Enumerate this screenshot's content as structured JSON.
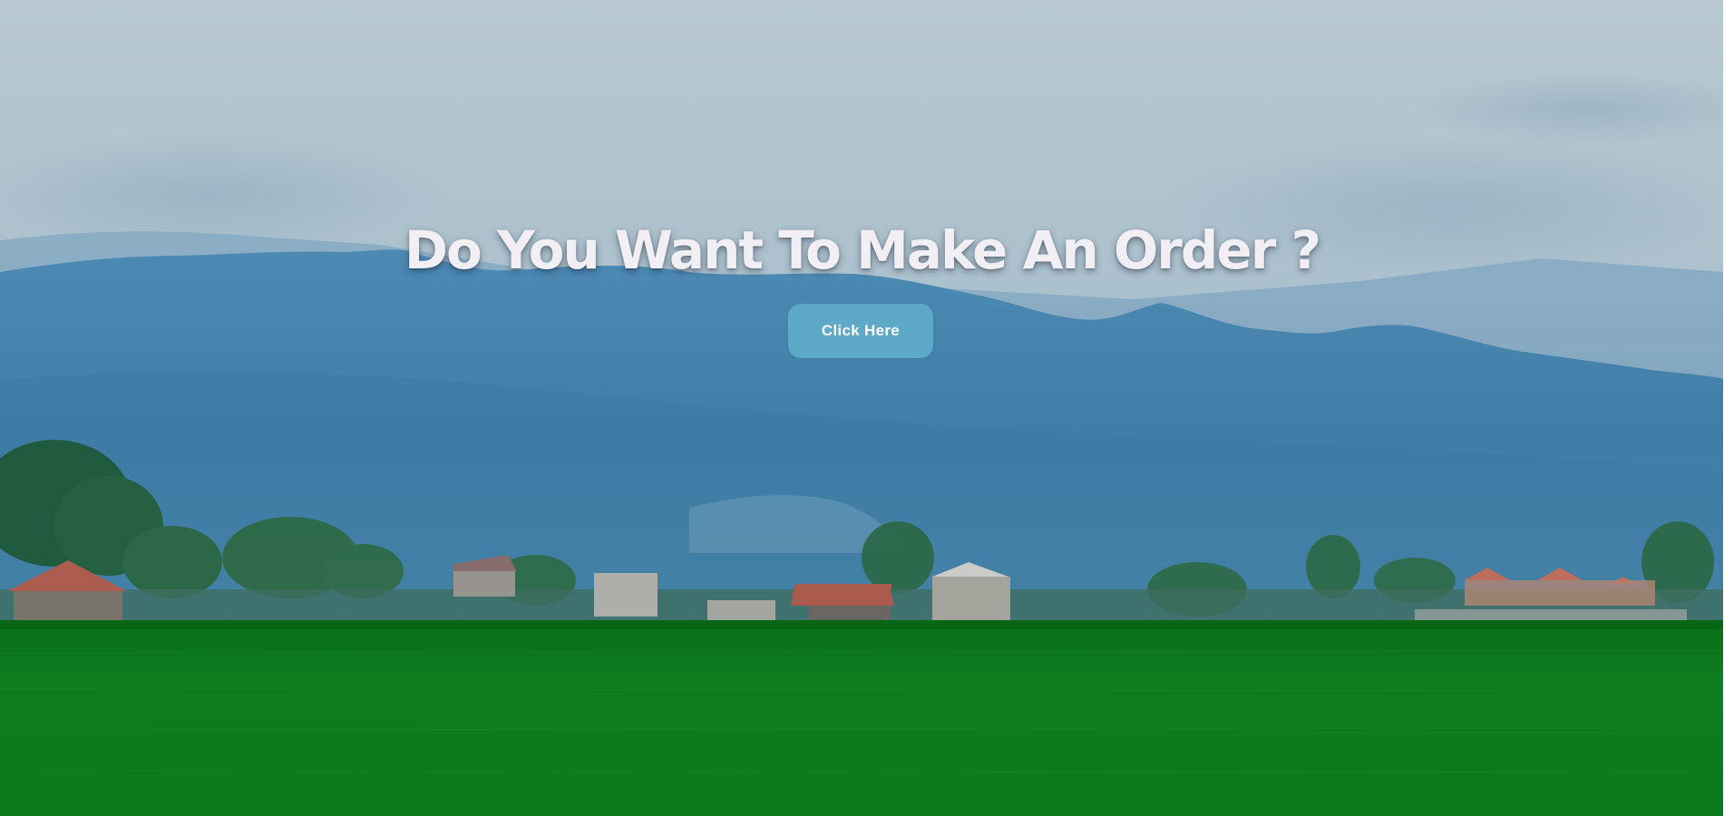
{
  "hero": {
    "headline": "Do You Want To Make An Order ?",
    "button_label": "Click Here",
    "background_image": "landscape-mountains-rice-field-village"
  },
  "colors": {
    "sky_top": "#b6c7d0",
    "mountain_blue": "#3f7ea9",
    "field_green": "#0b7a1c",
    "button_bg": "#5ea8c8",
    "headline_text": "#f2eff4"
  }
}
